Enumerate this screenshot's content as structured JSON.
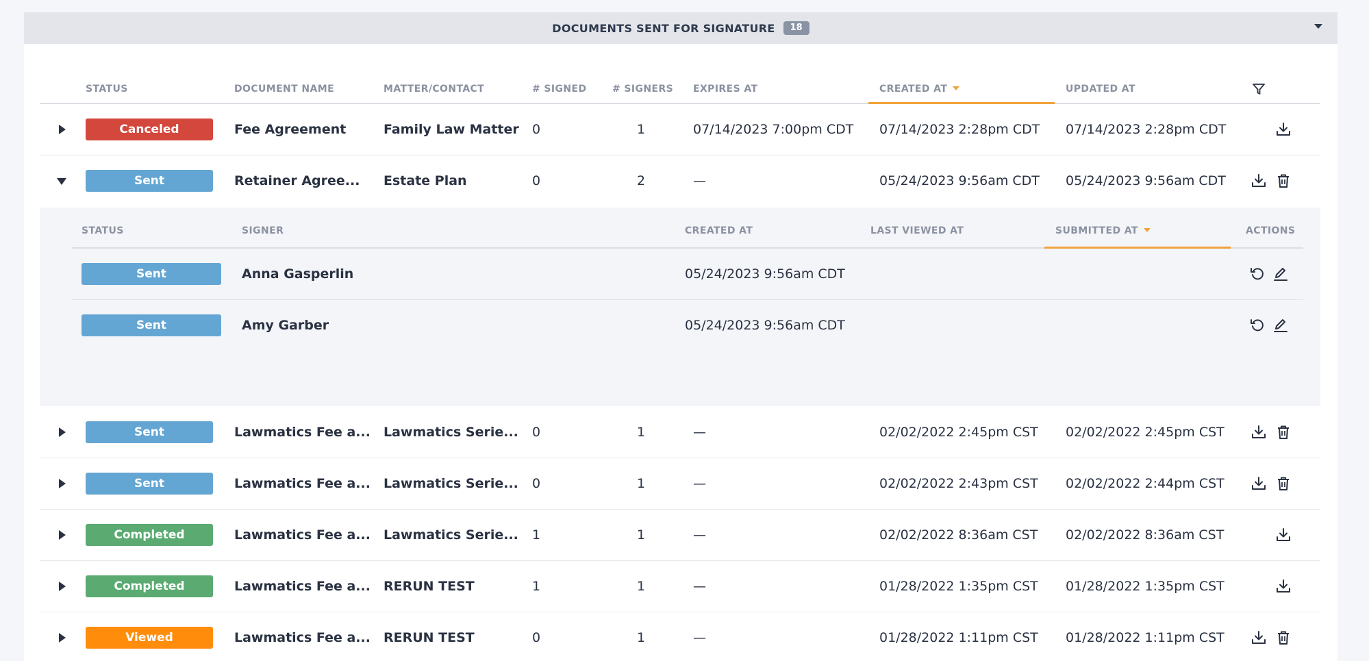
{
  "panel": {
    "title": "DOCUMENTS SENT FOR SIGNATURE",
    "count": "18"
  },
  "columns": {
    "status": "STATUS",
    "document_name": "DOCUMENT NAME",
    "matter_contact": "MATTER/CONTACT",
    "signed": "# SIGNED",
    "signers": "# SIGNERS",
    "expires_at": "EXPIRES AT",
    "created_at": "CREATED AT",
    "updated_at": "UPDATED AT"
  },
  "rows": [
    {
      "status": "Canceled",
      "document": "Fee Agreement",
      "matter": "Family Law Matter",
      "signed": "0",
      "signers": "1",
      "expires": "07/14/2023 7:00pm CDT",
      "created": "07/14/2023 2:28pm CDT",
      "updated": "07/14/2023 2:28pm CDT"
    },
    {
      "status": "Sent",
      "document": "Retainer Agree...",
      "matter": "Estate Plan",
      "signed": "0",
      "signers": "2",
      "expires": "—",
      "created": "05/24/2023 9:56am CDT",
      "updated": "05/24/2023 9:56am CDT"
    },
    {
      "status": "Sent",
      "document": "Lawmatics Fee a...",
      "matter": "Lawmatics Serie...",
      "signed": "0",
      "signers": "1",
      "expires": "—",
      "created": "02/02/2022 2:45pm CST",
      "updated": "02/02/2022 2:45pm CST"
    },
    {
      "status": "Sent",
      "document": "Lawmatics Fee a...",
      "matter": "Lawmatics Serie...",
      "signed": "0",
      "signers": "1",
      "expires": "—",
      "created": "02/02/2022 2:43pm CST",
      "updated": "02/02/2022 2:44pm CST"
    },
    {
      "status": "Completed",
      "document": "Lawmatics Fee a...",
      "matter": "Lawmatics Serie...",
      "signed": "1",
      "signers": "1",
      "expires": "—",
      "created": "02/02/2022 8:36am CST",
      "updated": "02/02/2022 8:36am CST"
    },
    {
      "status": "Completed",
      "document": "Lawmatics Fee a...",
      "matter": "RERUN TEST",
      "signed": "1",
      "signers": "1",
      "expires": "—",
      "created": "01/28/2022 1:35pm CST",
      "updated": "01/28/2022 1:35pm CST"
    },
    {
      "status": "Viewed",
      "document": "Lawmatics Fee a...",
      "matter": "RERUN TEST",
      "signed": "0",
      "signers": "1",
      "expires": "—",
      "created": "01/28/2022 1:11pm CST",
      "updated": "01/28/2022 1:11pm CST"
    }
  ],
  "signer_columns": {
    "status": "STATUS",
    "signer": "SIGNER",
    "created_at": "CREATED AT",
    "last_viewed_at": "LAST VIEWED AT",
    "submitted_at": "SUBMITTED AT",
    "actions": "ACTIONS"
  },
  "signers": [
    {
      "status": "Sent",
      "name": "Anna Gasperlin",
      "created": "05/24/2023 9:56am CDT"
    },
    {
      "status": "Sent",
      "name": "Amy Garber",
      "created": "05/24/2023 9:56am CDT"
    }
  ],
  "colors": {
    "canceled": "#d4473c",
    "sent": "#64a6d3",
    "completed": "#5aaa72",
    "viewed": "#ff8c0a",
    "sort_accent": "#f0a33a"
  }
}
